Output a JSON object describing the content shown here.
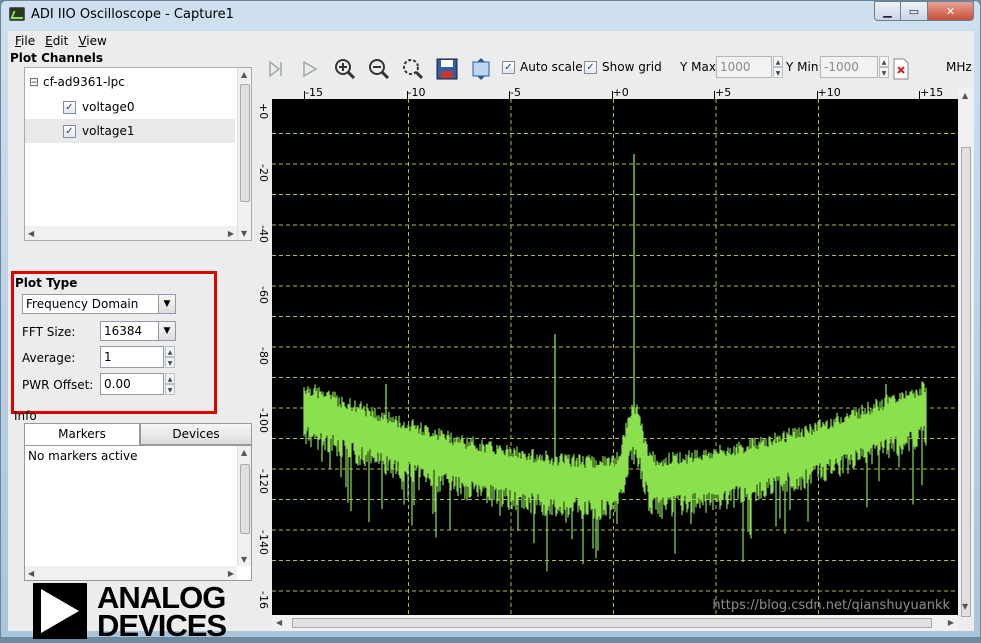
{
  "window": {
    "title": "ADI IIO Oscilloscope - Capture1",
    "controls": {
      "minimize": "▁",
      "maximize": "▭",
      "close": "✕"
    }
  },
  "menu": [
    {
      "key": "F",
      "rest": "ile"
    },
    {
      "key": "E",
      "rest": "dit"
    },
    {
      "key": "V",
      "rest": "iew"
    }
  ],
  "plot_channels": {
    "title": "Plot Channels",
    "device": "cf-ad9361-lpc",
    "channels": [
      {
        "label": "voltage0",
        "checked": true
      },
      {
        "label": "voltage1",
        "checked": true
      }
    ]
  },
  "plot_type": {
    "title": "Plot Type",
    "selected": "Frequency Domain",
    "fft_size_label": "FFT Size:",
    "fft_size_value": "16384",
    "average_label": "Average:",
    "average_value": "1",
    "pwr_offset_label": "PWR Offset:",
    "pwr_offset_value": "0.00"
  },
  "info": {
    "title": "Info",
    "tabs": [
      "Markers",
      "Devices"
    ],
    "active_tab": 0,
    "content": "No markers active"
  },
  "logo": {
    "line1": "ANALOG",
    "line2": "DEVICES"
  },
  "toolbar": {
    "auto_scale_label": "Auto scale",
    "auto_scale_checked": true,
    "show_grid_label": "Show grid",
    "show_grid_checked": true,
    "ymax_label": "Y Max:",
    "ymax_value": "1000",
    "ymin_label": "Y Min:",
    "ymin_value": "-1000",
    "unit": "MHz"
  },
  "plot": {
    "x_ticks": [
      "-15",
      "-10",
      "-5",
      "+0",
      "+5",
      "+10",
      "+15"
    ],
    "y_ticks": [
      "+0",
      "-20",
      "-40",
      "-60",
      "-80",
      "-100",
      "-120",
      "-140",
      "-16"
    ],
    "trace_color": "#8be04e",
    "grid_color": "#b8b83a",
    "background": "#000000"
  },
  "watermark": "https://blog.csdn.net/qianshuyuankk"
}
